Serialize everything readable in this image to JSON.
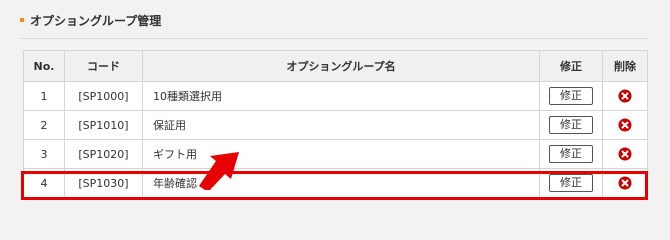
{
  "section": {
    "title": "オプショングループ管理"
  },
  "table": {
    "headers": {
      "no": "No.",
      "code": "コード",
      "name": "オプショングループ名",
      "edit": "修正",
      "delete": "削除"
    },
    "rows": [
      {
        "no": "1",
        "code": "[SP1000]",
        "name": "10種類選択用",
        "edit_label": "修正"
      },
      {
        "no": "2",
        "code": "[SP1010]",
        "name": "保証用",
        "edit_label": "修正"
      },
      {
        "no": "3",
        "code": "[SP1020]",
        "name": "ギフト用",
        "edit_label": "修正"
      },
      {
        "no": "4",
        "code": "[SP1030]",
        "name": "年齢確認",
        "edit_label": "修正"
      }
    ]
  },
  "icons": {
    "delete": "delete-x-icon",
    "pointer": "red-arrow-icon"
  },
  "colors": {
    "accent": "#ff8a00",
    "highlight": "#e60000",
    "delete_icon": "#c80000"
  }
}
